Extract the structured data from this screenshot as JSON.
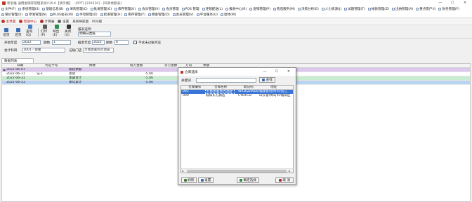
{
  "window": {
    "title": "新思维 通用进销存管理系统V10.0【演示版】 - [PPT] [220520] - [科目余额表]",
    "minimize": "—",
    "maximize": "☐",
    "close": "✕"
  },
  "menu": {
    "row1": [
      "文件(F)",
      "系统管理(S)",
      "基础信息(B)",
      "采购管理(C)",
      "批发管理(G)",
      "库存管理(K)",
      "会员管理(V)",
      "会员管理",
      "POS 管理",
      "连锁配送(L)",
      "报表中心(R)",
      "促销管理(P)",
      "售后服务(M)",
      "决策分析(E)",
      "人力资源(J)",
      "试题管理(T)",
      "帐款管理(Z)",
      "出纳管理(A)",
      "重点客户(I)",
      "财务管理(F)"
    ],
    "row2": [
      "限价管理(X)",
      "参发管理(N)",
      "PLUS会员(W)",
      "手动管理(D)",
      "批发管理(H)",
      "库存管理(Y)",
      "佣金管理(O)",
      "会员管理(V)",
      "平台服务(U)",
      "窗体(W)"
    ]
  },
  "tabs": [
    "主界面",
    "帮助中心",
    "计算器",
    "设置",
    "系统导航图",
    "POS端"
  ],
  "toolbar": {
    "buttons": [
      "前页",
      "后页",
      "查询(Q)",
      "打印(P)",
      "导出(E)",
      "关闭(X)"
    ],
    "report_label": "报表选项:",
    "report_value": "明细分类账"
  },
  "form": {
    "start_year_label": "开始年度",
    "start_year": "2022",
    "start_period_label": "期数",
    "start_period": "1",
    "end_year_label": "截至年度",
    "end_year": "2022",
    "end_period_label": "期数",
    "end_period": "6",
    "exclude_label": "不含未过账凭证",
    "account_label": "会计科目",
    "account_value": "1001 - 现金",
    "store_label": "记账门店",
    "store_value": "万佳达家利万达店"
  },
  "grid": {
    "tab_label": "数据列表",
    "columns": [
      "日期",
      "凭证字号",
      "摘要",
      "借方金额",
      "贷方金额",
      "方向",
      "余额"
    ],
    "rows": [
      {
        "date": "2022-06-01",
        "voucher": "",
        "summary": "期初余额",
        "debit": "",
        "credit": "",
        "dir": "",
        "balance": ""
      },
      {
        "date": "2022-06-11",
        "voucher": "记-1",
        "summary": "测试",
        "debit": "-5.00",
        "credit": "",
        "dir": "",
        "balance": ""
      },
      {
        "date": "2022-06-31",
        "voucher": "",
        "summary": "本期合计",
        "debit": "-5.00",
        "credit": "",
        "dir": "",
        "balance": ""
      },
      {
        "date": "2022-06-31",
        "voucher": "",
        "summary": "本年累计",
        "debit": "-5.00",
        "credit": "",
        "dir": "",
        "balance": ""
      }
    ]
  },
  "dialog": {
    "title": "仓库选择",
    "keyword_label": "关键词",
    "keyword_value": "",
    "search_label": "查找",
    "columns": [
      "仓库编号",
      "仓库名称",
      "助记码",
      "地址"
    ],
    "rows": [
      {
        "code": "001",
        "name": "万佳达家利万达店",
        "mnemonic": "WXDQZWDD",
        "address": "福建省/泉州市/晋江"
      },
      {
        "code": "009",
        "name": "城阳东方旗店",
        "mnemonic": "CYDFCD",
        "address": "山东省/青岛市/城阳区"
      }
    ],
    "btn_refresh": "刷新",
    "btn_settings": "设置",
    "btn_confirm": "确定选择",
    "btn_cancel": "取 消"
  },
  "colors": {
    "row_purple": "#dcc8ee",
    "row_green": "#c8ecd0",
    "row_blue": "#b9d3f2",
    "selected": "#3875d7",
    "tab_red": "#c0392b"
  }
}
